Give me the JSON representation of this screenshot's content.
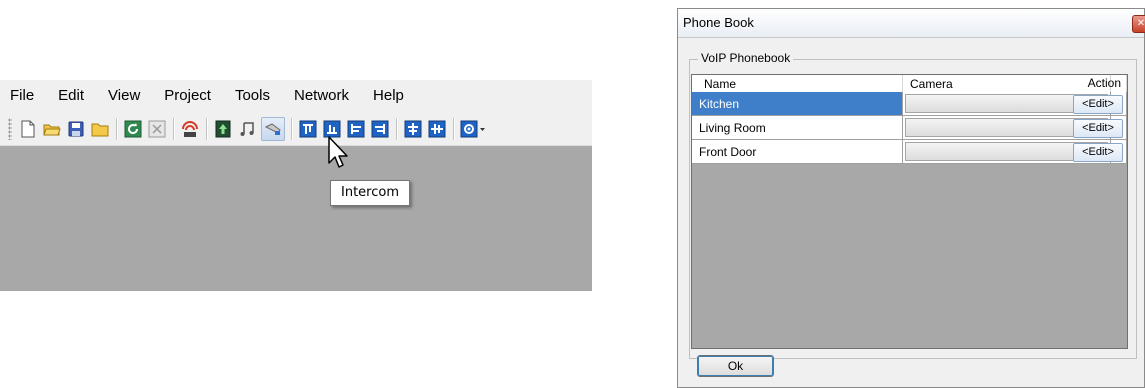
{
  "menu": [
    "File",
    "Edit",
    "View",
    "Project",
    "Tools",
    "Network",
    "Help"
  ],
  "toolbar": {
    "icons": [
      "new-file-icon",
      "open-folder-icon",
      "save-icon",
      "folder-icon",
      "refresh-icon",
      "close-project-icon",
      "signal-icon",
      "upload-icon",
      "music-icon",
      "intercom-icon",
      "align-top-icon",
      "align-bottom-icon",
      "align-left-icon",
      "align-right-icon",
      "center-horizontal-icon",
      "center-vertical-icon",
      "settings-dropdown-icon"
    ],
    "tooltip": "Intercom"
  },
  "dialog": {
    "title": "Phone Book",
    "group_label": "VoIP Phonebook",
    "columns": {
      "name": "Name",
      "camera": "Camera",
      "action": "Action"
    },
    "rows": [
      {
        "name": "Kitchen",
        "camera": "",
        "action": "<Edit>",
        "selected": true
      },
      {
        "name": "Living Room",
        "camera": "",
        "action": "<Edit>",
        "selected": false
      },
      {
        "name": "Front Door",
        "camera": "",
        "action": "<Edit>",
        "selected": false
      }
    ],
    "ok_label": "Ok"
  },
  "colors": {
    "selection": "#3f7fc9",
    "workspace": "#a8a8a8",
    "panel": "#f0f0f0"
  }
}
